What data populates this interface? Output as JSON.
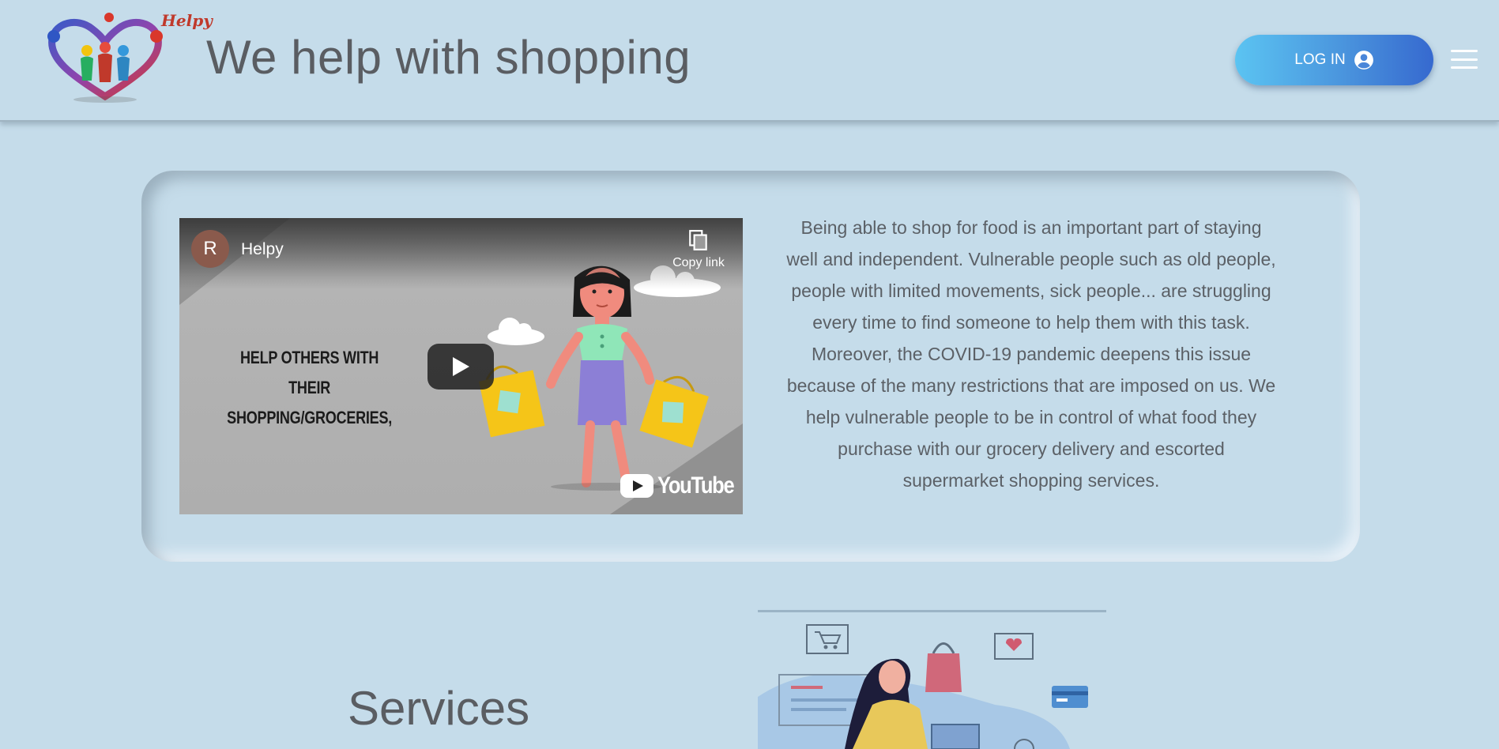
{
  "header": {
    "logo_text": "Helpy",
    "title": "We help with shopping",
    "login_label": "LOG IN"
  },
  "intro": {
    "video": {
      "channel_initial": "R",
      "channel_name": "Helpy",
      "copy_link_label": "Copy link",
      "headline": "HELP OTHERS WITH THEIR SHOPPING/GROCERIES,",
      "platform": "YouTube"
    },
    "text": "Being able to shop for food is an important part of staying well and independent. Vulnerable people such as old people, people with limited movements, sick people... are struggling every time to find someone to help them with this task. Moreover, the COVID-19 pandemic deepens this issue because of the many restrictions that are imposed on us. We help vulnerable people to be in control of what food they purchase with our grocery delivery and escorted supermarket shopping services."
  },
  "services": {
    "title": "Services"
  },
  "colors": {
    "background": "#c5dcea",
    "login_gradient_start": "#5bc4f2",
    "login_gradient_end": "#3669cf",
    "text": "#5a5d62"
  },
  "icons": [
    "helpy-logo",
    "user-circle-icon",
    "hamburger-menu-icon",
    "copy-icon",
    "play-icon",
    "youtube-logo-icon"
  ]
}
